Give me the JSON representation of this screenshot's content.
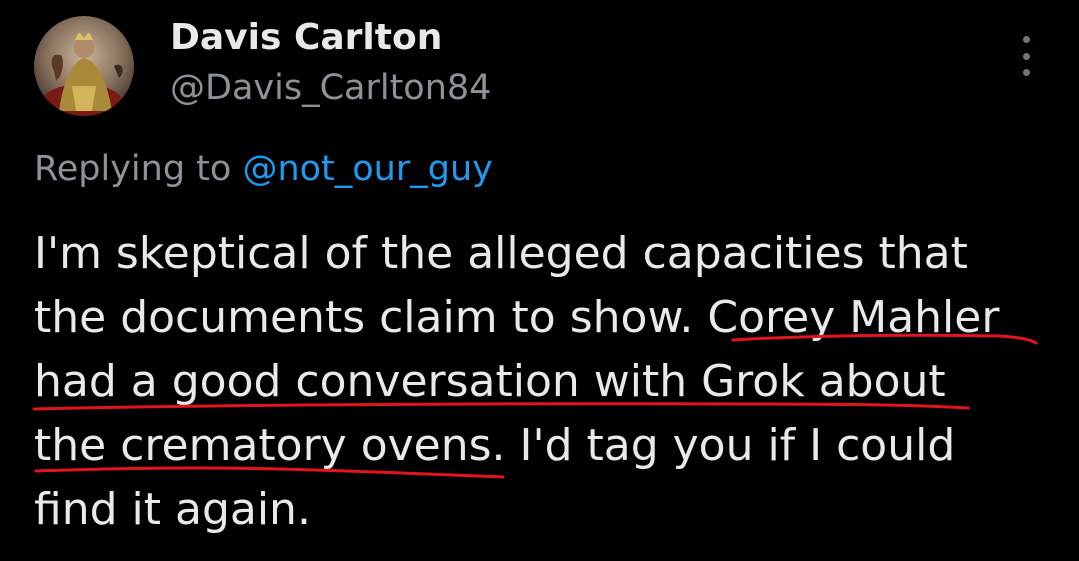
{
  "author": {
    "display_name": "Davis Carlton",
    "handle": "@Davis_Carlton84",
    "avatar_icon": "avatar-painting"
  },
  "menu": {
    "icon": "more-vertical-icon"
  },
  "reply": {
    "prefix": "Replying to ",
    "mention": "@not_our_guy"
  },
  "tweet": {
    "lines": [
      "I'm skeptical of the alleged capacities that",
      "the documents claim to show. Corey Mahler",
      "had a good conversation with Grok about",
      "the crematory ovens. I'd tag you if I could",
      "find it again."
    ]
  },
  "annotation": {
    "underline_color": "#e3141d"
  },
  "colors": {
    "background": "#000000",
    "text": "#e7e9ea",
    "secondary_text": "#8b9299",
    "link": "#1d9bf0"
  }
}
